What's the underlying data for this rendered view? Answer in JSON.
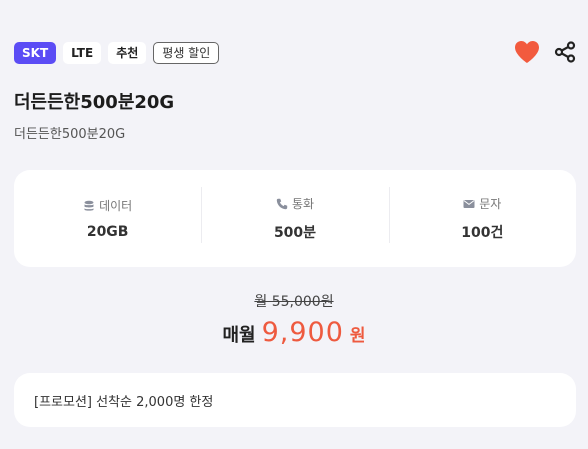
{
  "tags": [
    "SKT",
    "LTE",
    "추천",
    "평생 할인"
  ],
  "actions": {
    "favorite_icon": "heart-icon",
    "share_icon": "share-icon",
    "favorite_color": "#f25a3e"
  },
  "plan": {
    "title": "더든든한500분20G",
    "subtitle": "더든든한500분20G"
  },
  "specs": [
    {
      "icon": "database-icon",
      "label": "데이터",
      "value": "20GB"
    },
    {
      "icon": "phone-icon",
      "label": "통화",
      "value": "500분"
    },
    {
      "icon": "mail-icon",
      "label": "문자",
      "value": "100건"
    }
  ],
  "price": {
    "original": "월 55,000원",
    "monthly_label": "매월",
    "monthly_value": "9,900",
    "monthly_unit": "원",
    "accent_color": "#ee5a3f"
  },
  "promotion": "[프로모션] 선착순 2,000명 한정"
}
